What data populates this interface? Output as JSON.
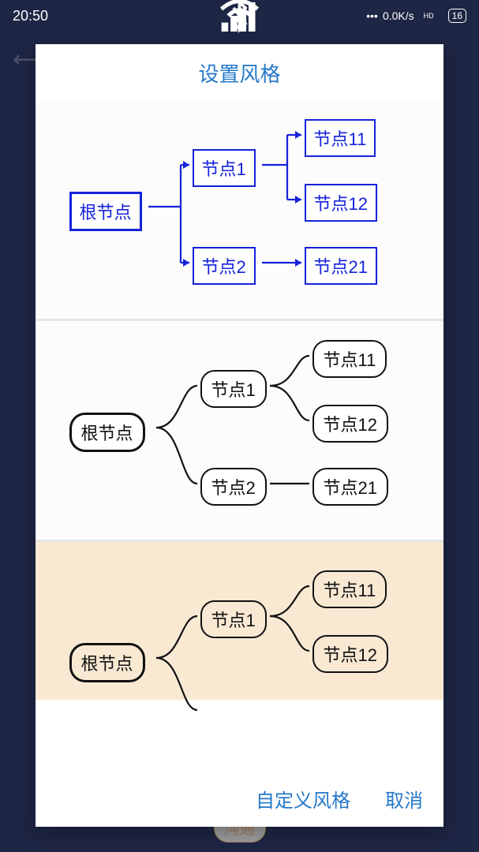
{
  "status_bar": {
    "time": "20:50",
    "net_speed": "0.0K/s",
    "hd": "HD",
    "battery": "16"
  },
  "dialog": {
    "title": "设置风格",
    "footer": {
      "custom_label": "自定义风格",
      "cancel_label": "取消"
    }
  },
  "sample_nodes": {
    "root": "根节点",
    "n1": "节点1",
    "n2": "节点2",
    "n11": "节点11",
    "n12": "节点12",
    "n21": "节点21"
  },
  "background": {
    "bottom_text": "沟通"
  }
}
